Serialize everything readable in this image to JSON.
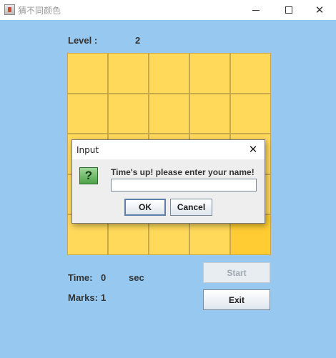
{
  "window": {
    "title": "猜不同颜色",
    "controls": {
      "minimize_icon": "minimize-icon",
      "maximize_icon": "maximize-icon",
      "close_icon": "close-icon",
      "close_glyph": "✕"
    }
  },
  "game": {
    "level_label": "Level :",
    "level_value": "2",
    "grid_size": 5,
    "odd_cell_index": 24,
    "colors": {
      "background": "#96c8f0",
      "cell": "#ffd95a",
      "odd_cell": "#ffcc33"
    },
    "time_label": "Time:",
    "time_value": "0",
    "time_unit": "sec",
    "marks_label": "Marks:",
    "marks_value": "1",
    "start_button": "Start",
    "exit_button": "Exit"
  },
  "dialog": {
    "title": "Input",
    "close_glyph": "✕",
    "icon": "question-icon",
    "icon_glyph": "?",
    "message": "Time's up! please enter your name!",
    "input_value": "",
    "ok_button": "OK",
    "cancel_button": "Cancel"
  }
}
